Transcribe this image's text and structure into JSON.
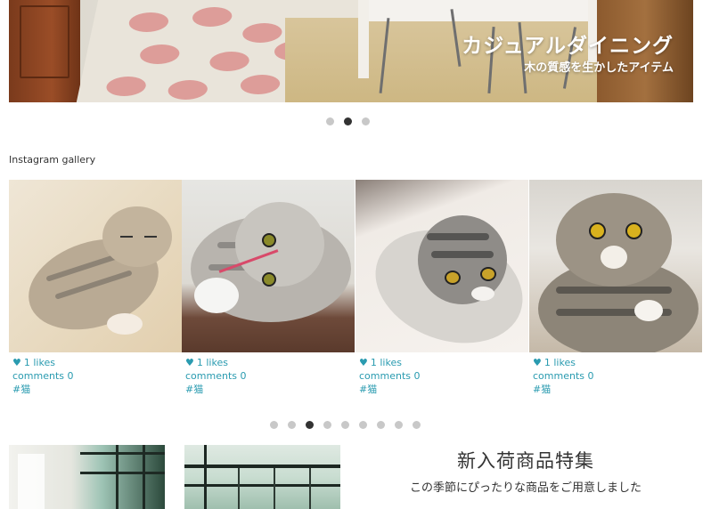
{
  "hero": {
    "title": "カジュアルダイニング",
    "subtitle": "木の質感を生かしたアイテム"
  },
  "hero_pager": {
    "count": 3,
    "active": 2
  },
  "gallery": {
    "heading": "Instagram gallery",
    "items": [
      {
        "likes": "1 likes",
        "comments": "comments 0",
        "tag": "#猫"
      },
      {
        "likes": "1 likes",
        "comments": "comments 0",
        "tag": "#猫"
      },
      {
        "likes": "1 likes",
        "comments": "comments 0",
        "tag": "#猫"
      },
      {
        "likes": "1 likes",
        "comments": "comments 0",
        "tag": "#猫"
      }
    ]
  },
  "gallery_pager": {
    "count": 9,
    "active": 3
  },
  "feature": {
    "title": "新入荷商品特集",
    "subtitle": "この季節にぴったりな商品をご用意しました"
  },
  "colors": {
    "link": "#2a9bb0",
    "dot_active": "#333333",
    "dot_inactive": "#c8c8c8"
  },
  "icons": {
    "like": "heart-icon"
  }
}
